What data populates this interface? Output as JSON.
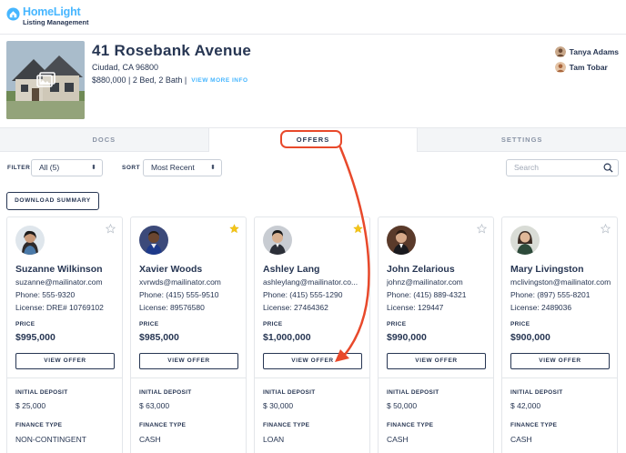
{
  "app": {
    "brand": "HomeLight",
    "subtitle": "Listing Management"
  },
  "property": {
    "title": "41 Rosebank Avenue",
    "city": "Ciudad, CA 96800",
    "summary": "$880,000 | 2 Bed, 2 Bath |",
    "view_more": "VIEW MORE INFO",
    "agents": [
      "Tanya Adams",
      "Tam Tobar"
    ]
  },
  "tabs": [
    {
      "label": "DOCS",
      "active": false
    },
    {
      "label": "OFFERS",
      "active": true
    },
    {
      "label": "SETTINGS",
      "active": false
    }
  ],
  "filters": {
    "filter_label": "FILTER",
    "filter_value": "All (5)",
    "sort_label": "SORT",
    "sort_value": "Most Recent",
    "search_placeholder": "Search"
  },
  "download_label": "DOWNLOAD SUMMARY",
  "labels": {
    "price": "PRICE",
    "view_offer": "VIEW OFFER",
    "initial_deposit": "INITIAL DEPOSIT",
    "finance_type": "FINANCE TYPE"
  },
  "offers": [
    {
      "name": "Suzanne Wilkinson",
      "email": "suzanne@mailinator.com",
      "phone": "Phone: 555-9320",
      "license": "License: DRE# 10769102",
      "price": "$995,000",
      "deposit": "$ 25,000",
      "finance": "NON-CONTINGENT",
      "starred": false
    },
    {
      "name": "Xavier Woods",
      "email": "xvrwds@mailinator.com",
      "phone": "Phone: (415) 555-9510",
      "license": "License: 89576580",
      "price": "$985,000",
      "deposit": "$ 63,000",
      "finance": "CASH",
      "starred": true
    },
    {
      "name": "Ashley Lang",
      "email": "ashleylang@mailinator.co...",
      "phone": "Phone: (415) 555-1290",
      "license": "License: 27464362",
      "price": "$1,000,000",
      "deposit": "$ 30,000",
      "finance": "LOAN",
      "starred": true
    },
    {
      "name": "John Zelarious",
      "email": "johnz@mailinator.com",
      "phone": "Phone: (415) 889-4321",
      "license": "License: 129447",
      "price": "$990,000",
      "deposit": "$ 50,000",
      "finance": "CASH",
      "starred": false
    },
    {
      "name": "Mary Livingston",
      "email": "mclivingston@mailinator.com",
      "phone": "Phone: (897) 555-8201",
      "license": "License: 2489036",
      "price": "$900,000",
      "deposit": "$ 42,000",
      "finance": "CASH",
      "starred": false
    }
  ],
  "colors": {
    "brand": "#46b6ff",
    "navy": "#273653",
    "star_active": "#f5c518",
    "highlight": "#e8492b"
  }
}
